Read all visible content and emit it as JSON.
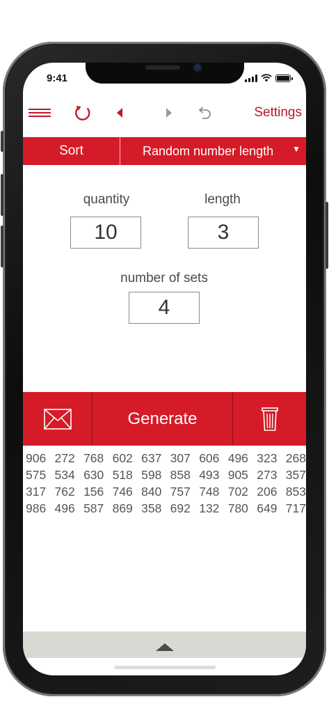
{
  "status_bar": {
    "time": "9:41"
  },
  "toolbar": {
    "menu_icon": "hamburger-icon",
    "refresh_icon": "refresh-icon",
    "back_icon": "triangle-left-icon",
    "forward_icon": "triangle-right-icon",
    "undo_icon": "undo-icon",
    "settings_label": "Settings"
  },
  "tabs": {
    "sort_label": "Sort",
    "mode_label": "Random number length"
  },
  "form": {
    "quantity": {
      "label": "quantity",
      "value": "10"
    },
    "length": {
      "label": "length",
      "value": "3"
    },
    "sets": {
      "label": "number of sets",
      "value": "4"
    }
  },
  "actions": {
    "mail_icon": "envelope-icon",
    "generate_label": "Generate",
    "trash_icon": "trash-icon"
  },
  "results": [
    [
      "906",
      "272",
      "768",
      "602",
      "637",
      "307",
      "606",
      "496",
      "323",
      "268"
    ],
    [
      "575",
      "534",
      "630",
      "518",
      "598",
      "858",
      "493",
      "905",
      "273",
      "357"
    ],
    [
      "317",
      "762",
      "156",
      "746",
      "840",
      "757",
      "748",
      "702",
      "206",
      "853"
    ],
    [
      "986",
      "496",
      "587",
      "869",
      "358",
      "692",
      "132",
      "780",
      "649",
      "717"
    ]
  ],
  "colors": {
    "accent": "#d51b27",
    "accent_text": "#b8152a",
    "drawer": "#d9d9d3"
  }
}
